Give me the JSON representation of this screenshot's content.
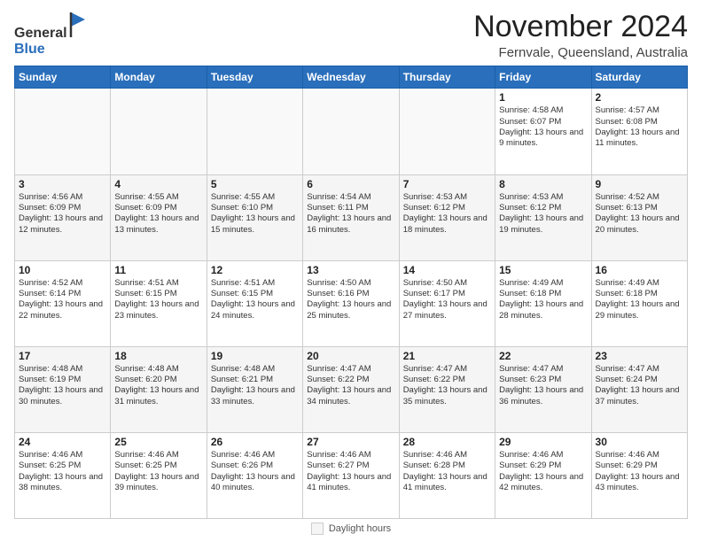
{
  "header": {
    "logo_general": "General",
    "logo_blue": "Blue",
    "month_title": "November 2024",
    "location": "Fernvale, Queensland, Australia"
  },
  "footer": {
    "daylight_label": "Daylight hours"
  },
  "weekdays": [
    "Sunday",
    "Monday",
    "Tuesday",
    "Wednesday",
    "Thursday",
    "Friday",
    "Saturday"
  ],
  "weeks": [
    [
      {
        "day": "",
        "info": ""
      },
      {
        "day": "",
        "info": ""
      },
      {
        "day": "",
        "info": ""
      },
      {
        "day": "",
        "info": ""
      },
      {
        "day": "",
        "info": ""
      },
      {
        "day": "1",
        "info": "Sunrise: 4:58 AM\nSunset: 6:07 PM\nDaylight: 13 hours and 9 minutes."
      },
      {
        "day": "2",
        "info": "Sunrise: 4:57 AM\nSunset: 6:08 PM\nDaylight: 13 hours and 11 minutes."
      }
    ],
    [
      {
        "day": "3",
        "info": "Sunrise: 4:56 AM\nSunset: 6:09 PM\nDaylight: 13 hours and 12 minutes."
      },
      {
        "day": "4",
        "info": "Sunrise: 4:55 AM\nSunset: 6:09 PM\nDaylight: 13 hours and 13 minutes."
      },
      {
        "day": "5",
        "info": "Sunrise: 4:55 AM\nSunset: 6:10 PM\nDaylight: 13 hours and 15 minutes."
      },
      {
        "day": "6",
        "info": "Sunrise: 4:54 AM\nSunset: 6:11 PM\nDaylight: 13 hours and 16 minutes."
      },
      {
        "day": "7",
        "info": "Sunrise: 4:53 AM\nSunset: 6:12 PM\nDaylight: 13 hours and 18 minutes."
      },
      {
        "day": "8",
        "info": "Sunrise: 4:53 AM\nSunset: 6:12 PM\nDaylight: 13 hours and 19 minutes."
      },
      {
        "day": "9",
        "info": "Sunrise: 4:52 AM\nSunset: 6:13 PM\nDaylight: 13 hours and 20 minutes."
      }
    ],
    [
      {
        "day": "10",
        "info": "Sunrise: 4:52 AM\nSunset: 6:14 PM\nDaylight: 13 hours and 22 minutes."
      },
      {
        "day": "11",
        "info": "Sunrise: 4:51 AM\nSunset: 6:15 PM\nDaylight: 13 hours and 23 minutes."
      },
      {
        "day": "12",
        "info": "Sunrise: 4:51 AM\nSunset: 6:15 PM\nDaylight: 13 hours and 24 minutes."
      },
      {
        "day": "13",
        "info": "Sunrise: 4:50 AM\nSunset: 6:16 PM\nDaylight: 13 hours and 25 minutes."
      },
      {
        "day": "14",
        "info": "Sunrise: 4:50 AM\nSunset: 6:17 PM\nDaylight: 13 hours and 27 minutes."
      },
      {
        "day": "15",
        "info": "Sunrise: 4:49 AM\nSunset: 6:18 PM\nDaylight: 13 hours and 28 minutes."
      },
      {
        "day": "16",
        "info": "Sunrise: 4:49 AM\nSunset: 6:18 PM\nDaylight: 13 hours and 29 minutes."
      }
    ],
    [
      {
        "day": "17",
        "info": "Sunrise: 4:48 AM\nSunset: 6:19 PM\nDaylight: 13 hours and 30 minutes."
      },
      {
        "day": "18",
        "info": "Sunrise: 4:48 AM\nSunset: 6:20 PM\nDaylight: 13 hours and 31 minutes."
      },
      {
        "day": "19",
        "info": "Sunrise: 4:48 AM\nSunset: 6:21 PM\nDaylight: 13 hours and 33 minutes."
      },
      {
        "day": "20",
        "info": "Sunrise: 4:47 AM\nSunset: 6:22 PM\nDaylight: 13 hours and 34 minutes."
      },
      {
        "day": "21",
        "info": "Sunrise: 4:47 AM\nSunset: 6:22 PM\nDaylight: 13 hours and 35 minutes."
      },
      {
        "day": "22",
        "info": "Sunrise: 4:47 AM\nSunset: 6:23 PM\nDaylight: 13 hours and 36 minutes."
      },
      {
        "day": "23",
        "info": "Sunrise: 4:47 AM\nSunset: 6:24 PM\nDaylight: 13 hours and 37 minutes."
      }
    ],
    [
      {
        "day": "24",
        "info": "Sunrise: 4:46 AM\nSunset: 6:25 PM\nDaylight: 13 hours and 38 minutes."
      },
      {
        "day": "25",
        "info": "Sunrise: 4:46 AM\nSunset: 6:25 PM\nDaylight: 13 hours and 39 minutes."
      },
      {
        "day": "26",
        "info": "Sunrise: 4:46 AM\nSunset: 6:26 PM\nDaylight: 13 hours and 40 minutes."
      },
      {
        "day": "27",
        "info": "Sunrise: 4:46 AM\nSunset: 6:27 PM\nDaylight: 13 hours and 41 minutes."
      },
      {
        "day": "28",
        "info": "Sunrise: 4:46 AM\nSunset: 6:28 PM\nDaylight: 13 hours and 41 minutes."
      },
      {
        "day": "29",
        "info": "Sunrise: 4:46 AM\nSunset: 6:29 PM\nDaylight: 13 hours and 42 minutes."
      },
      {
        "day": "30",
        "info": "Sunrise: 4:46 AM\nSunset: 6:29 PM\nDaylight: 13 hours and 43 minutes."
      }
    ]
  ]
}
